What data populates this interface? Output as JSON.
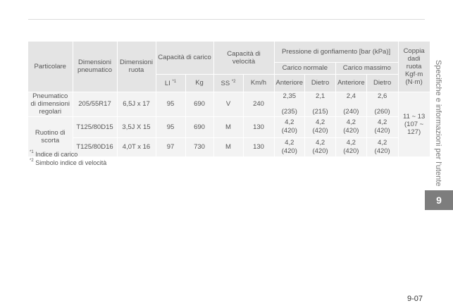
{
  "headers": {
    "particolare": "Particolare",
    "dimensioni_pneumatico": "Dimensioni pneumatico",
    "dimensioni_ruota": "Dimensioni ruota",
    "capacita_carico": "Capacità di carico",
    "capacita_velocita": "Capacità di velocità",
    "pressione": "Pressione di gonfiamento [bar (kPa)]",
    "coppia": "Coppia dadi ruota Kgf·m (N·m)",
    "li": "LI",
    "li_note": "*1",
    "kg": "Kg",
    "ss": "SS",
    "ss_note": "*2",
    "kmh": "Km/h",
    "carico_normale": "Carico normale",
    "carico_massimo": "Carico massimo",
    "anteriore": "Anteriore",
    "dietro": "Dietro"
  },
  "groups": {
    "pneumatico_regolari": "Pneumatico di dimensioni regolari",
    "ruotino_scorta": "Ruotino di scorta"
  },
  "rows": [
    {
      "tire": "205/55R17",
      "wheel": "6,5J x 17",
      "li": "95",
      "kg": "690",
      "ss": "V",
      "kmh": "240",
      "pressure": [
        [
          "2,35",
          "2,1",
          "2,4",
          "2,6"
        ],
        [
          "(235)",
          "(215)",
          "(240)",
          "(260)"
        ]
      ]
    },
    {
      "tire": "T125/80D15",
      "wheel": "3,5J X 15",
      "li": "95",
      "kg": "690",
      "ss": "M",
      "kmh": "130",
      "pressure": [
        [
          "4,2",
          "4,2",
          "4,2",
          "4,2"
        ],
        [
          "(420)",
          "(420)",
          "(420)",
          "(420)"
        ]
      ]
    },
    {
      "tire": "T125/80D16",
      "wheel": "4,0T x 16",
      "li": "97",
      "kg": "730",
      "ss": "M",
      "kmh": "130",
      "pressure": [
        [
          "4,2",
          "4,2",
          "4,2",
          "4,2"
        ],
        [
          "(420)",
          "(420)",
          "(420)",
          "(420)"
        ]
      ]
    }
  ],
  "coppia_value": "11 ~ 13 (107 ~ 127)",
  "notes": [
    {
      "mark": "*1",
      "text": "Indice di carico"
    },
    {
      "mark": "*2",
      "text": "Simbolo indice di velocità"
    }
  ],
  "side_title": "Specifiche e informazioni per l'utente",
  "chapter": "9",
  "page_number": "9-07"
}
